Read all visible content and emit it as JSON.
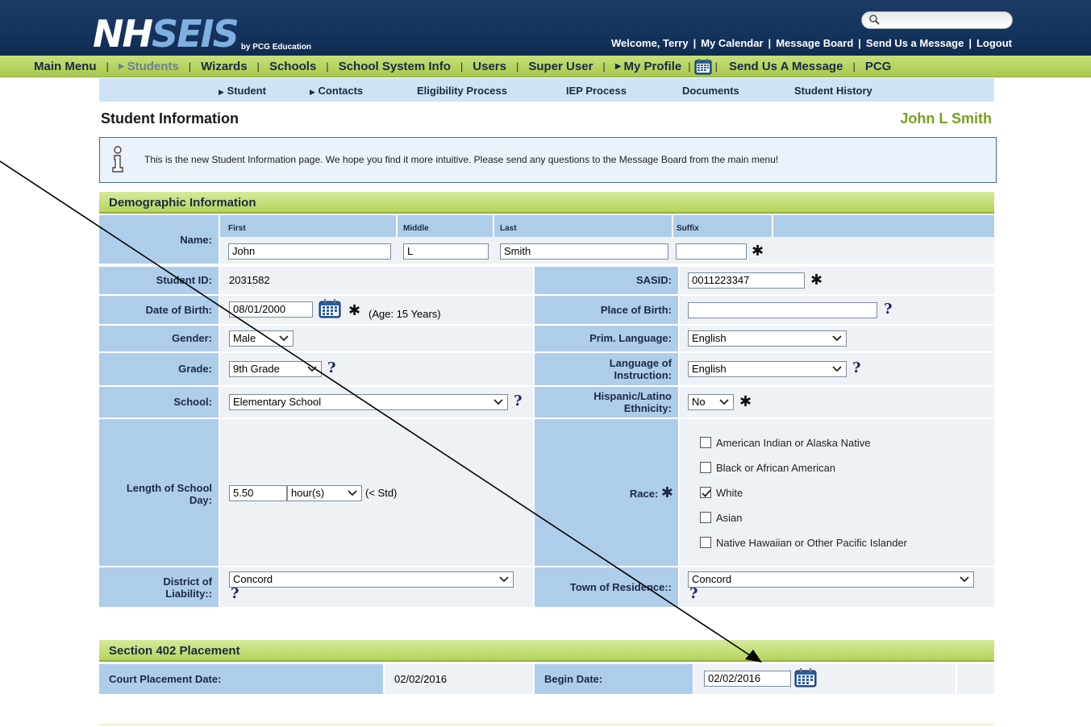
{
  "header": {
    "logo_main_1": "NH",
    "logo_main_2": "SEIS",
    "logo_sub": "by PCG Education",
    "search_placeholder": "",
    "top_links": [
      "Welcome, Terry",
      "My Calendar",
      "Message Board",
      "Send Us a Message",
      "Logout"
    ]
  },
  "mainnav": {
    "items": [
      "Main Menu",
      "Students",
      "Wizards",
      "Schools",
      "School System Info",
      "Users",
      "Super User",
      "My Profile",
      "Send Us A Message",
      "PCG"
    ]
  },
  "subnav": {
    "items": [
      "Student",
      "Contacts",
      "Eligibility Process",
      "IEP Process",
      "Documents",
      "Student History"
    ]
  },
  "page": {
    "title": "Student Information",
    "student_name": "John L Smith",
    "info_message": "This is the new Student Information page. We hope you find it more intuitive. Please send any questions to the Message Board from the main menu!"
  },
  "demographic": {
    "section_title": "Demographic Information",
    "name_label": "Name:",
    "first_label": "First",
    "middle_label": "Middle",
    "last_label": "Last",
    "suffix_label": "Suffix",
    "first_value": "John",
    "middle_value": "L",
    "last_value": "Smith",
    "suffix_value": "",
    "student_id_label": "Student ID:",
    "student_id_value": "2031582",
    "sasid_label": "SASID:",
    "sasid_value": "0011223347",
    "dob_label": "Date of Birth:",
    "dob_value": "08/01/2000",
    "age_text": "(Age: 15 Years)",
    "pob_label": "Place of Birth:",
    "pob_value": "",
    "gender_label": "Gender:",
    "gender_value": "Male",
    "prim_lang_label": "Prim. Language:",
    "prim_lang_value": "English",
    "grade_label": "Grade:",
    "grade_value": "9th Grade",
    "lang_instr_label_1": "Language of",
    "lang_instr_label_2": "Instruction:",
    "lang_instr_value": "English",
    "school_label": "School:",
    "school_value": "Elementary School",
    "hispanic_label_1": "Hispanic/Latino",
    "hispanic_label_2": "Ethnicity:",
    "hispanic_value": "No",
    "length_label_1": "Length of School",
    "length_label_2": "Day:",
    "length_value": "5.50",
    "length_unit": "hour(s)",
    "length_note": "(< Std)",
    "race_label": "Race:",
    "race_options": [
      {
        "label": "American Indian or Alaska Native",
        "checked": false
      },
      {
        "label": "Black or African American",
        "checked": false
      },
      {
        "label": "White",
        "checked": true
      },
      {
        "label": "Asian",
        "checked": false
      },
      {
        "label": "Native Hawaiian or Other Pacific Islander",
        "checked": false
      }
    ],
    "district_label_1": "District of",
    "district_label_2": "Liability::",
    "district_value": "Concord",
    "town_label": "Town of Residence::",
    "town_value": "Concord"
  },
  "section402": {
    "section_title": "Section 402 Placement",
    "court_label": "Court Placement Date:",
    "court_value": "02/02/2016",
    "begin_label": "Begin Date:",
    "begin_value": "02/02/2016"
  },
  "symbols": {
    "required": "✱",
    "help": "?"
  },
  "colors": {
    "header_bg": "#14345e",
    "nav_green": "#a9c94f",
    "label_blue": "#aecdea",
    "name_green": "#78a020"
  }
}
